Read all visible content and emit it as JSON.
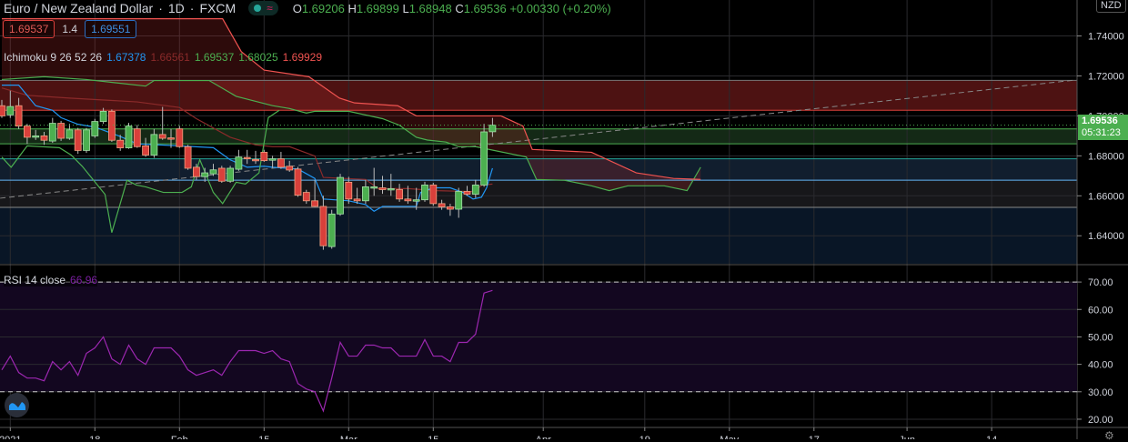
{
  "header": {
    "symbol": "Euro / New Zealand Dollar",
    "interval": "1D",
    "exchange": "FXCM",
    "sep": "·",
    "o_label": "O",
    "o": "1.69206",
    "h_label": "H",
    "h": "1.69899",
    "l_label": "L",
    "l": "1.68948",
    "c_label": "C",
    "c": "1.69536",
    "change": "+0.00330 (+0.20%)"
  },
  "quote": {
    "sell": "1.69537",
    "spread": "1.4",
    "buy": "1.69551"
  },
  "ichimoku": {
    "name": "Ichimoku 9 26 52 26",
    "tenkan": "1.67378",
    "kijun": "1.66561",
    "lead1": "1.69537",
    "lagging": "1.68025",
    "lead2": "1.69929"
  },
  "rsi": {
    "name": "RSI 14 close",
    "value": "66.96"
  },
  "currency_button": "NZD",
  "price_tag": {
    "price": "1.69536",
    "countdown": "05:31:23"
  },
  "colors": {
    "up": "#4caf50",
    "down": "#d9403b",
    "tenkan": "#2196f3",
    "kijun": "#8b2a2a",
    "lead1": "#4caf50",
    "lead2": "#ef5350",
    "rsi": "#9c27b0",
    "bg": "#000000"
  },
  "chart_data": {
    "type": "candlestick",
    "title": "Euro / New Zealand Dollar · 1D · FXCM",
    "price_axis": {
      "ylim": [
        1.626,
        1.758
      ],
      "ticks": [
        "1.74000",
        "1.72000",
        "1.70000",
        "1.68000",
        "1.66000",
        "1.64000"
      ],
      "tick_values": [
        1.74,
        1.72,
        1.7,
        1.68,
        1.66,
        1.64
      ]
    },
    "time_axis": {
      "labels": [
        {
          "i": 1,
          "t": "2021"
        },
        {
          "i": 11,
          "t": "18"
        },
        {
          "i": 21,
          "t": "Feb"
        },
        {
          "i": 31,
          "t": "15"
        },
        {
          "i": 41,
          "t": "Mar"
        },
        {
          "i": 51,
          "t": "15"
        },
        {
          "i": 64,
          "t": "Apr"
        },
        {
          "i": 76,
          "t": "19"
        },
        {
          "i": 86,
          "t": "May"
        },
        {
          "i": 96,
          "t": "17"
        },
        {
          "i": 107,
          "t": "Jun"
        },
        {
          "i": 117,
          "t": "14"
        }
      ]
    },
    "candles": [
      [
        1.7051,
        1.708,
        1.699,
        1.7
      ],
      [
        1.7005,
        1.7126,
        1.699,
        1.7047
      ],
      [
        1.7051,
        1.709,
        1.6935,
        1.6949
      ],
      [
        1.6949,
        1.696,
        1.686,
        1.6893
      ],
      [
        1.6898,
        1.693,
        1.688,
        1.69
      ],
      [
        1.69,
        1.692,
        1.6855,
        1.6878
      ],
      [
        1.6874,
        1.699,
        1.6865,
        1.6963
      ],
      [
        1.6963,
        1.6975,
        1.6875,
        1.6888
      ],
      [
        1.6888,
        1.696,
        1.688,
        1.693
      ],
      [
        1.693,
        1.694,
        1.681,
        1.6827
      ],
      [
        1.6827,
        1.694,
        1.6815,
        1.693
      ],
      [
        1.69,
        1.6985,
        1.689,
        1.6972
      ],
      [
        1.6972,
        1.704,
        1.696,
        1.7023
      ],
      [
        1.7023,
        1.7032,
        1.687,
        1.6878
      ],
      [
        1.6878,
        1.6905,
        1.6825,
        1.684
      ],
      [
        1.684,
        1.6965,
        1.6835,
        1.6949
      ],
      [
        1.6935,
        1.6955,
        1.684,
        1.6846
      ],
      [
        1.685,
        1.689,
        1.6795,
        1.6804
      ],
      [
        1.6804,
        1.6935,
        1.679,
        1.6907
      ],
      [
        1.6907,
        1.7045,
        1.688,
        1.6888
      ],
      [
        1.689,
        1.6935,
        1.684,
        1.6888
      ],
      [
        1.6935,
        1.695,
        1.684,
        1.6846
      ],
      [
        1.6846,
        1.6855,
        1.673,
        1.6738
      ],
      [
        1.6743,
        1.676,
        1.668,
        1.6696
      ],
      [
        1.6696,
        1.674,
        1.667,
        1.6715
      ],
      [
        1.671,
        1.676,
        1.67,
        1.673
      ],
      [
        1.6738,
        1.675,
        1.6665,
        1.6673
      ],
      [
        1.6673,
        1.675,
        1.6665,
        1.6738
      ],
      [
        1.6733,
        1.683,
        1.6725,
        1.6794
      ],
      [
        1.6792,
        1.683,
        1.676,
        1.679
      ],
      [
        1.6782,
        1.6825,
        1.676,
        1.678
      ],
      [
        1.6818,
        1.683,
        1.677,
        1.6776
      ],
      [
        1.6778,
        1.68,
        1.674,
        1.6785
      ],
      [
        1.6785,
        1.682,
        1.6735,
        1.6743
      ],
      [
        1.6748,
        1.6775,
        1.672,
        1.6729
      ],
      [
        1.6734,
        1.6745,
        1.6595,
        1.6603
      ],
      [
        1.6617,
        1.663,
        1.656,
        1.6575
      ],
      [
        1.6575,
        1.668,
        1.6545,
        1.6547
      ],
      [
        1.6547,
        1.66,
        1.633,
        1.635
      ],
      [
        1.6346,
        1.653,
        1.6335,
        1.6509
      ],
      [
        1.6509,
        1.671,
        1.65,
        1.6692
      ],
      [
        1.6668,
        1.6695,
        1.656,
        1.6584
      ],
      [
        1.6584,
        1.664,
        1.656,
        1.6575
      ],
      [
        1.6575,
        1.668,
        1.656,
        1.6645
      ],
      [
        1.6645,
        1.674,
        1.66,
        1.6645
      ],
      [
        1.664,
        1.67,
        1.661,
        1.6631
      ],
      [
        1.6631,
        1.671,
        1.66,
        1.6636
      ],
      [
        1.6631,
        1.666,
        1.657,
        1.6584
      ],
      [
        1.6584,
        1.665,
        1.656,
        1.6575
      ],
      [
        1.6578,
        1.664,
        1.653,
        1.658
      ],
      [
        1.658,
        1.667,
        1.657,
        1.6654
      ],
      [
        1.6654,
        1.6665,
        1.655,
        1.6561
      ],
      [
        1.6561,
        1.658,
        1.653,
        1.6545
      ],
      [
        1.6545,
        1.656,
        1.65,
        1.6533
      ],
      [
        1.6533,
        1.664,
        1.649,
        1.6622
      ],
      [
        1.6622,
        1.665,
        1.66,
        1.6608
      ],
      [
        1.6608,
        1.668,
        1.659,
        1.6654
      ],
      [
        1.6654,
        1.696,
        1.6645,
        1.692
      ],
      [
        1.69206,
        1.69899,
        1.68948,
        1.69536
      ]
    ],
    "ichimoku_lines": {
      "tenkan": [
        [
          0,
          1.7154
        ],
        [
          2,
          1.7154
        ],
        [
          4,
          1.7051
        ],
        [
          6,
          1.7028
        ],
        [
          7,
          1.6991
        ],
        [
          9,
          1.6958
        ],
        [
          11,
          1.6944
        ],
        [
          14,
          1.6897
        ],
        [
          16,
          1.686
        ],
        [
          21,
          1.685
        ],
        [
          25,
          1.6841
        ],
        [
          27,
          1.678
        ],
        [
          29,
          1.6743
        ],
        [
          31,
          1.6748
        ],
        [
          32,
          1.6743
        ],
        [
          35,
          1.6734
        ],
        [
          37,
          1.6687
        ],
        [
          38,
          1.6584
        ],
        [
          41,
          1.6575
        ],
        [
          43,
          1.6556
        ],
        [
          44,
          1.6523
        ],
        [
          45,
          1.6547
        ],
        [
          47,
          1.6547
        ],
        [
          49,
          1.6547
        ],
        [
          49.5,
          1.6617
        ],
        [
          51,
          1.664
        ],
        [
          53,
          1.664
        ],
        [
          54.5,
          1.6617
        ],
        [
          55.7,
          1.6584
        ],
        [
          56.7,
          1.6593
        ],
        [
          57.3,
          1.664
        ],
        [
          58,
          1.6738
        ]
      ],
      "kijun": [
        [
          0,
          1.714
        ],
        [
          3,
          1.7103
        ],
        [
          8,
          1.7089
        ],
        [
          16,
          1.707
        ],
        [
          21,
          1.7042
        ],
        [
          23,
          1.6986
        ],
        [
          27,
          1.6893
        ],
        [
          30,
          1.6855
        ],
        [
          32,
          1.6846
        ],
        [
          34,
          1.6846
        ],
        [
          37,
          1.6799
        ],
        [
          38,
          1.6692
        ],
        [
          43,
          1.6682
        ],
        [
          44.5,
          1.6636
        ],
        [
          48,
          1.6636
        ],
        [
          51.4,
          1.6626
        ],
        [
          55.7,
          1.6621
        ],
        [
          56.8,
          1.6654
        ],
        [
          58,
          1.6659
        ]
      ],
      "lead1": [
        [
          0,
          1.7182
        ],
        [
          5,
          1.7196
        ],
        [
          10,
          1.7182
        ],
        [
          17,
          1.7149
        ],
        [
          18,
          1.7177
        ],
        [
          24.5,
          1.7177
        ],
        [
          27.7,
          1.7098
        ],
        [
          32,
          1.7051
        ],
        [
          34,
          1.7037
        ],
        [
          36,
          1.7014
        ],
        [
          37,
          1.7023
        ],
        [
          41,
          1.7023
        ],
        [
          45,
          1.6986
        ],
        [
          47,
          1.6953
        ],
        [
          49,
          1.6893
        ],
        [
          50.3,
          1.6879
        ],
        [
          52.5,
          1.6869
        ],
        [
          54,
          1.6846
        ],
        [
          56,
          1.6846
        ],
        [
          62,
          1.6794
        ],
        [
          63.2,
          1.6682
        ],
        [
          66.5,
          1.6678
        ],
        [
          69.7,
          1.665
        ],
        [
          71.8,
          1.6626
        ],
        [
          74,
          1.665
        ],
        [
          78.3,
          1.665
        ],
        [
          81,
          1.6626
        ],
        [
          82.6,
          1.6743
        ]
      ],
      "lead2": [
        [
          0,
          1.7486
        ],
        [
          26.1,
          1.7486
        ],
        [
          28.3,
          1.7322
        ],
        [
          31,
          1.7229
        ],
        [
          36.3,
          1.7196
        ],
        [
          39.9,
          1.7089
        ],
        [
          41.7,
          1.7065
        ],
        [
          46.8,
          1.7051
        ],
        [
          49,
          1.7
        ],
        [
          59,
          1.7
        ],
        [
          61.6,
          1.6949
        ],
        [
          62.7,
          1.6832
        ],
        [
          69.7,
          1.6818
        ],
        [
          75,
          1.6715
        ],
        [
          79.4,
          1.6687
        ],
        [
          82.6,
          1.6682
        ]
      ],
      "lagging": [
        [
          0,
          1.6794
        ],
        [
          1.1,
          1.6743
        ],
        [
          3,
          1.685
        ],
        [
          6.8,
          1.6841
        ],
        [
          8.2,
          1.6804
        ],
        [
          9.5,
          1.6748
        ],
        [
          12.2,
          1.6607
        ],
        [
          13,
          1.6416
        ],
        [
          14.8,
          1.6678
        ],
        [
          15.9,
          1.6654
        ],
        [
          17,
          1.6645
        ],
        [
          19.1,
          1.6617
        ],
        [
          21.3,
          1.6617
        ],
        [
          22.4,
          1.6645
        ],
        [
          23.4,
          1.6781
        ],
        [
          25,
          1.6617
        ],
        [
          26.1,
          1.6561
        ],
        [
          27.7,
          1.6668
        ],
        [
          28.8,
          1.6659
        ],
        [
          30.4,
          1.6715
        ],
        [
          31.5,
          1.6991
        ],
        [
          32.8,
          1.7028
        ]
      ],
      "senkou_b_at_right": "1.69929"
    },
    "levels": [
      {
        "name": "resistance-zone",
        "from": 1.7178,
        "to": 1.7028,
        "color": "#5a1515"
      },
      {
        "name": "current-zone",
        "from": 1.6935,
        "to": 1.686,
        "color": "#17301a"
      },
      {
        "name": "mid-zone",
        "from": 1.6785,
        "to": 1.6678,
        "color": "#142336"
      },
      {
        "name": "support-zone",
        "from": 1.6678,
        "to": 1.6542,
        "color": "#1b1b1e"
      },
      {
        "name": "lower-zone",
        "from": 1.6542,
        "to": 1.626,
        "color": "#0b1a2d"
      }
    ],
    "trendline": {
      "from": [
        -0.2,
        1.6588
      ],
      "to": [
        127,
        1.718
      ]
    },
    "current_price": 1.69536,
    "rsi_series": {
      "ylim": [
        17,
        76
      ],
      "ticks": [
        "70.00",
        "60.00",
        "50.00",
        "40.00",
        "30.00",
        "20.00"
      ],
      "tick_values": [
        70,
        60,
        50,
        40,
        30,
        20
      ],
      "bands": [
        30,
        70
      ],
      "values": [
        38,
        43,
        37,
        35,
        35,
        34,
        41,
        38,
        41,
        36,
        44,
        46,
        50,
        42,
        40,
        47,
        42,
        40,
        46,
        46,
        46,
        43,
        38,
        36,
        37,
        38,
        36,
        41,
        45,
        45,
        45,
        44,
        45,
        42,
        41,
        33,
        31,
        30,
        23,
        35,
        48,
        43,
        43,
        47,
        47,
        46,
        46,
        43,
        43,
        43,
        49,
        43,
        43,
        41,
        48,
        48,
        51,
        66,
        66.96
      ]
    }
  }
}
